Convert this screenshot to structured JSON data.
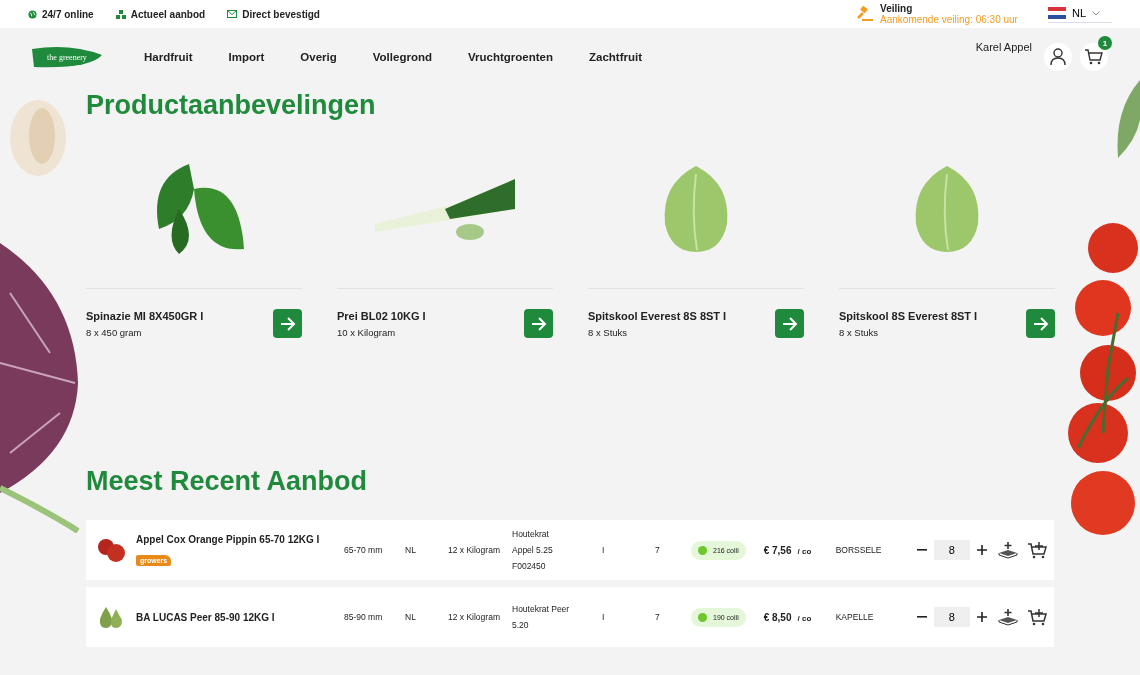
{
  "usps": [
    {
      "kind": "globe",
      "label": "24/7 online"
    },
    {
      "kind": "boxes",
      "label": "Actueel aanbod"
    },
    {
      "kind": "mail",
      "label": "Direct bevestigd"
    }
  ],
  "auction": {
    "title": "Veiling",
    "subtitle": "Aankomende veiling: 06:30 uur"
  },
  "language": {
    "label": "NL"
  },
  "logo": {
    "text": "the greenery"
  },
  "nav": [
    "Hardfruit",
    "Import",
    "Overig",
    "Vollegrond",
    "Vruchtgroenten",
    "Zachtfruit"
  ],
  "user": {
    "name": "Karel Appel",
    "cart_count": "1"
  },
  "recommendations": {
    "title": "Productaanbevelingen",
    "products": [
      {
        "name": "Spinazie MI 8X450GR I",
        "unit": "8 x 450 gram"
      },
      {
        "name": "Prei BL02 10KG I",
        "unit": "10 x Kilogram"
      },
      {
        "name": "Spitskool Everest 8S 8ST I",
        "unit": "8 x Stuks"
      },
      {
        "name": "Spitskool 8S Everest 8ST I",
        "unit": "8 x Stuks"
      }
    ]
  },
  "recent": {
    "title": "Meest Recent Aanbod",
    "rows": [
      {
        "name": "Appel Cox Orange Pippin 65-70 12KG I",
        "badge": "growers",
        "size": "65-70 mm",
        "origin": "NL",
        "package": "12 x Kilogram",
        "packaging": [
          "Houtekrat",
          "Appel 5.25",
          "F002450"
        ],
        "class": "I",
        "count": "7",
        "colli": "216 colli",
        "price": "€ 7,56",
        "per": "/ co",
        "location": "BORSSELE",
        "quantity": "8"
      },
      {
        "name": "BA LUCAS Peer 85-90 12KG I",
        "size": "85-90 mm",
        "origin": "NL",
        "package": "12 x Kilogram",
        "packaging": [
          "Houtekrat Peer",
          "5.20"
        ],
        "class": "I",
        "count": "7",
        "colli": "190 colli",
        "price": "€ 8,50",
        "per": "/ co",
        "location": "KAPELLE",
        "quantity": "8"
      }
    ]
  }
}
